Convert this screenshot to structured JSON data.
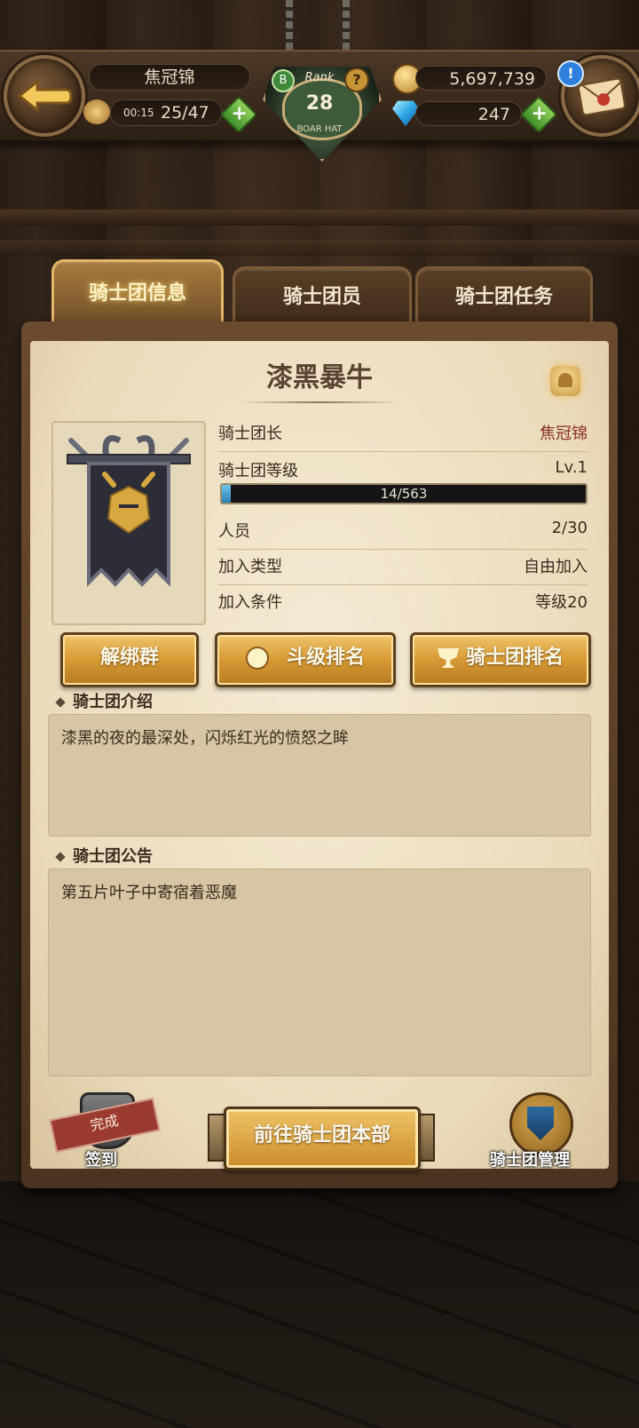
{
  "header": {
    "player_name": "焦冠锦",
    "stamina_time": "00:15",
    "stamina": "25/47",
    "rank_label": "Rank",
    "rank_value": "28",
    "rank_badge": "B",
    "help_glyph": "?",
    "emblem_caption": "BOAR HAT",
    "gold": "5,697,739",
    "gems": "247",
    "plus_glyph": "+",
    "alert_glyph": "!"
  },
  "tabs": [
    {
      "label": "骑士团信息",
      "active": true
    },
    {
      "label": "骑士团员",
      "active": false
    },
    {
      "label": "骑士团任务",
      "active": false
    }
  ],
  "guild": {
    "name": "漆黑暴牛",
    "leader_label": "骑士团长",
    "leader_value": "焦冠锦",
    "level_label": "骑士团等级",
    "level_value": "Lv.1",
    "xp_text": "14/563",
    "xp_fraction": 0.025,
    "members_label": "人员",
    "members_value": "2/30",
    "join_type_label": "加入类型",
    "join_type_value": "自由加入",
    "join_cond_label": "加入条件",
    "join_cond_value": "等级20"
  },
  "buttons": {
    "unbind_group": "解绑群",
    "fight_rank": "斗级排名",
    "guild_rank": "骑士团排名",
    "go_hq": "前往骑士团本部",
    "checkin_stamp": "完成",
    "checkin_label": "签到",
    "manage_label": "骑士团管理"
  },
  "intro": {
    "title": "骑士团介绍",
    "text": "漆黑的夜的最深处，闪烁红光的愤怒之眸"
  },
  "notice": {
    "title": "骑士团公告",
    "text": "第五片叶子中寄宿着恶魔"
  },
  "icons": {
    "back": "back-arrow-icon",
    "mail": "mail-icon",
    "gold": "gold-coin-icon",
    "gem": "gem-icon",
    "bell": "bell-icon",
    "medal": "medal-icon",
    "trophy": "trophy-icon",
    "banner": "guild-banner-icon"
  },
  "colors": {
    "accent_gold": "#d79a34",
    "leader_name": "#8a2f21",
    "xp_fill": "#2a7fb5",
    "parchment": "#eadbbc"
  }
}
